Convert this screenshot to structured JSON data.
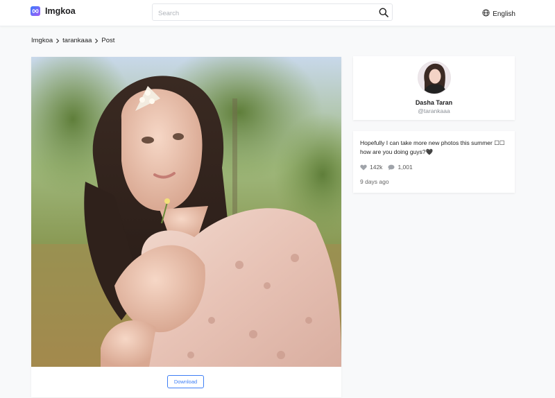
{
  "header": {
    "brand": "Imgkoa",
    "search_placeholder": "Search",
    "language": "English"
  },
  "breadcrumb": {
    "items": [
      "Imgkoa",
      "tarankaaa",
      "Post"
    ]
  },
  "post": {
    "image_description": "girl in floral dress with pearl hair clip",
    "download_label": "Download"
  },
  "profile": {
    "name": "Dasha Taran",
    "handle": "@tarankaaa"
  },
  "caption": {
    "text": "Hopefully I can take more new photos this summer ☐☐ how are you doing guys?🖤",
    "likes": "142k",
    "comments": "1,001",
    "posted": "9 days ago"
  },
  "colors": {
    "accent": "#3d7ef5",
    "brand_gradient_start": "#3a7bfd",
    "brand_gradient_end": "#a35cf5"
  }
}
